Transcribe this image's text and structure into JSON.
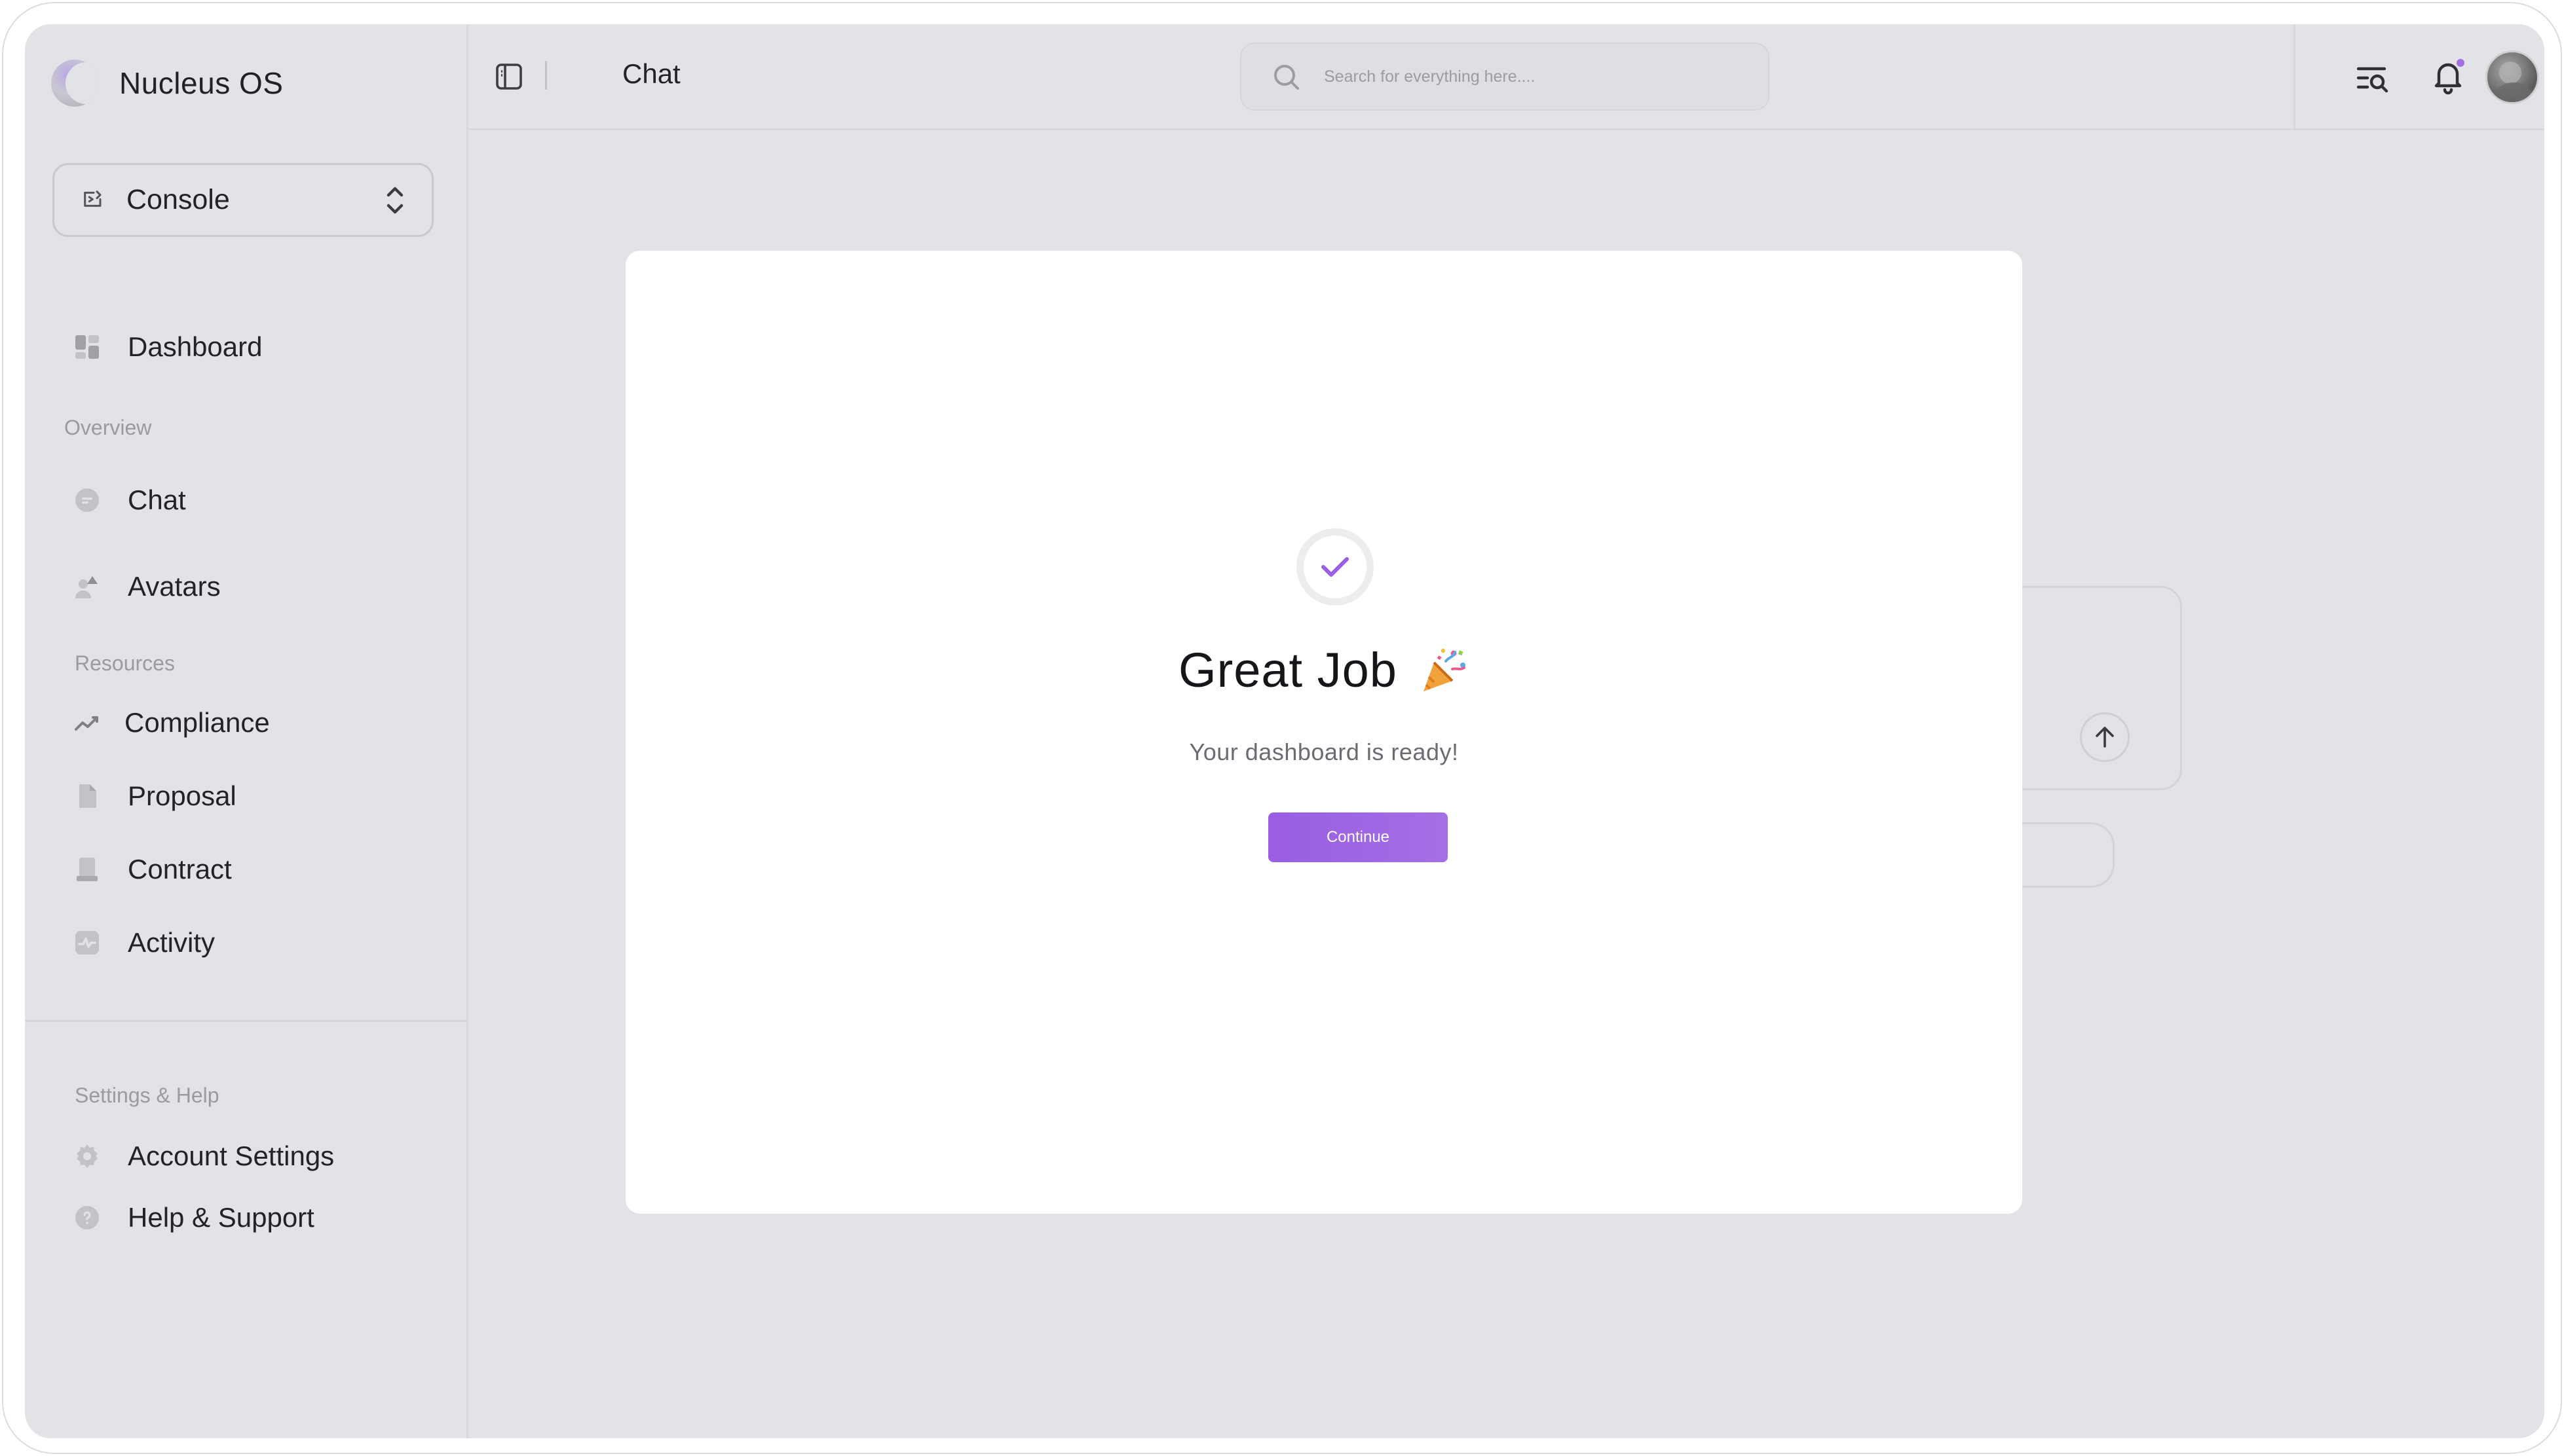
{
  "app": {
    "name": "Nucleus OS"
  },
  "workspace": {
    "label": "Console"
  },
  "sidebar": {
    "dashboard": "Dashboard",
    "sections": {
      "overview": "Overview",
      "resources": "Resources",
      "settings_help": "Settings & Help"
    },
    "overview_items": [
      "Chat",
      "Avatars"
    ],
    "resources_items": [
      "Compliance",
      "Proposal",
      "Contract",
      "Activity"
    ],
    "settings_items": [
      "Account Settings",
      "Help & Support"
    ]
  },
  "header": {
    "title": "Chat",
    "search_placeholder": "Search for everything here....",
    "has_notification": true
  },
  "modal": {
    "title": "Great Job",
    "subtitle": "Your dashboard is ready!",
    "button": "Continue",
    "icon": "party-popper-icon"
  },
  "colors": {
    "accent": "#9a5de3",
    "background": "#e2e3e6",
    "surface": "#ffffff"
  }
}
